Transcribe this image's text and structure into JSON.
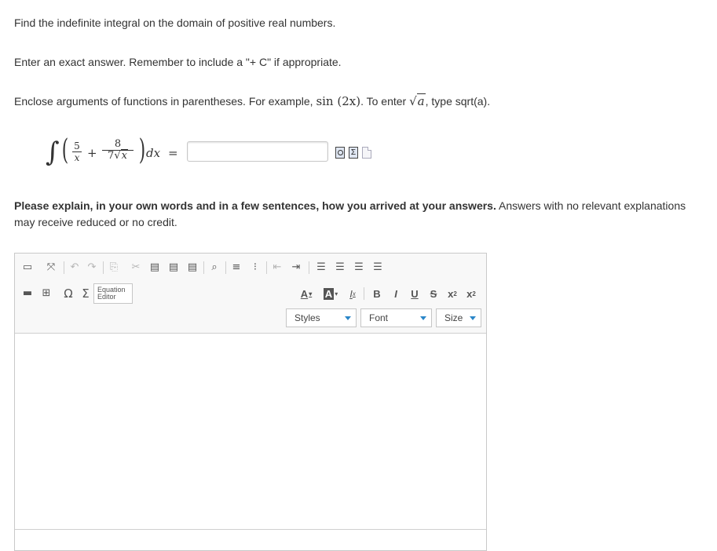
{
  "instructions": {
    "line1": "Find the indefinite integral on the domain of positive real numbers.",
    "line2": "Enter an exact answer. Remember to include a \"+ C\" if appropriate.",
    "line3_prefix": "Enclose arguments of functions in parentheses. For example, ",
    "line3_example_func": "sin",
    "line3_example_arg": "(2x)",
    "line3_mid": ". To enter ",
    "line3_sqrt_arg": "a",
    "line3_suffix": ", type sqrt(a)."
  },
  "problem": {
    "integral_sign": "∫",
    "frac1_num": "5",
    "frac1_den": "x",
    "plus": "+",
    "frac2_num": "8",
    "frac2_den_coef": "7",
    "frac2_den_var": "x",
    "differential": "dx",
    "equals": "=",
    "answer_value": "",
    "tool_icons": [
      "preview-icon",
      "equation-editor-icon",
      "help-icon"
    ]
  },
  "explanation": {
    "bold": "Please explain, in your own words and in a few sentences, how you arrived at your answers.",
    "rest": " Answers with no relevant explanations may receive reduced or no credit."
  },
  "editor": {
    "row1_icons": [
      "source-icon",
      "maximize-icon",
      "undo-icon",
      "redo-icon",
      "copy-icon",
      "cut-icon",
      "paste-icon",
      "paste-text-icon",
      "paste-word-icon",
      "find-icon",
      "numbered-list-icon",
      "bulleted-list-icon",
      "outdent-icon",
      "indent-icon",
      "align-left-icon",
      "align-center-icon",
      "align-right-icon",
      "justify-icon"
    ],
    "row2_icons": [
      "horizontal-line-icon",
      "table-icon",
      "omega-icon",
      "sigma-icon"
    ],
    "equation_editor_label_1": "Equation",
    "equation_editor_label_2": "Editor",
    "text_color": "A",
    "bg_color": "A",
    "remove_format": "I",
    "bold": "B",
    "italic": "I",
    "underline": "U",
    "strike": "S",
    "subscript": "x",
    "superscript": "x",
    "styles_label": "Styles",
    "font_label": "Font",
    "size_label": "Size",
    "accent_color": "#2a86c8"
  }
}
